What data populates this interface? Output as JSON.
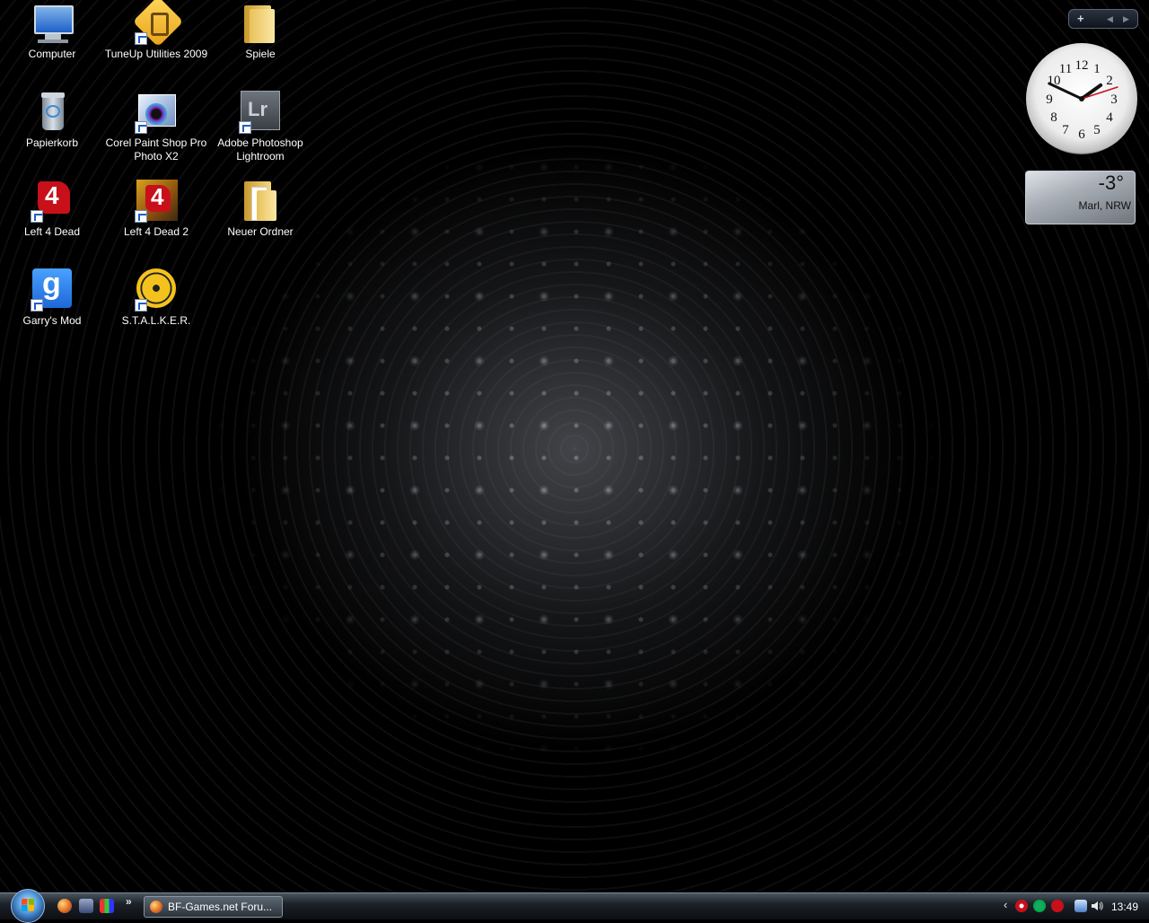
{
  "desktop": {
    "icons": [
      {
        "label": "Computer",
        "icon": "computer-icon"
      },
      {
        "label": "TuneUp Utilities 2009",
        "icon": "tuneup-icon"
      },
      {
        "label": "Spiele",
        "icon": "folder-icon"
      },
      {
        "label": "Papierkorb",
        "icon": "recycle-bin-icon"
      },
      {
        "label": "Corel Paint Shop Pro Photo X2",
        "icon": "corel-paintshop-icon"
      },
      {
        "label": "Adobe Photoshop Lightroom",
        "icon": "lightroom-icon"
      },
      {
        "label": "Left 4 Dead",
        "icon": "left4dead-icon"
      },
      {
        "label": "Left 4 Dead 2",
        "icon": "left4dead2-icon"
      },
      {
        "label": "Neuer Ordner",
        "icon": "folder-icon"
      },
      {
        "label": "Garry's Mod",
        "icon": "garrysmod-icon"
      },
      {
        "label": "S.T.A.L.K.E.R.",
        "icon": "stalker-icon"
      }
    ],
    "lightroom_badge": "Lr",
    "l4d_badge": "4",
    "gmod_badge": "g"
  },
  "gadgets": {
    "bar": {
      "add": "+",
      "prev": "◀",
      "next": "▶"
    },
    "clock": {
      "hours": 1,
      "minutes": 49,
      "seconds": 12
    },
    "weather": {
      "temperature": "-3°",
      "location": "Marl, NRW"
    }
  },
  "taskbar": {
    "quick_launch_more": "»",
    "window_button": "BF-Games.net Foru...",
    "tray_arrow": "‹",
    "time": "13:49"
  },
  "colors": {
    "accent_blue": "#1f5fc8",
    "l4d_red": "#c8101a",
    "folder_yellow": "#e9c25a"
  }
}
